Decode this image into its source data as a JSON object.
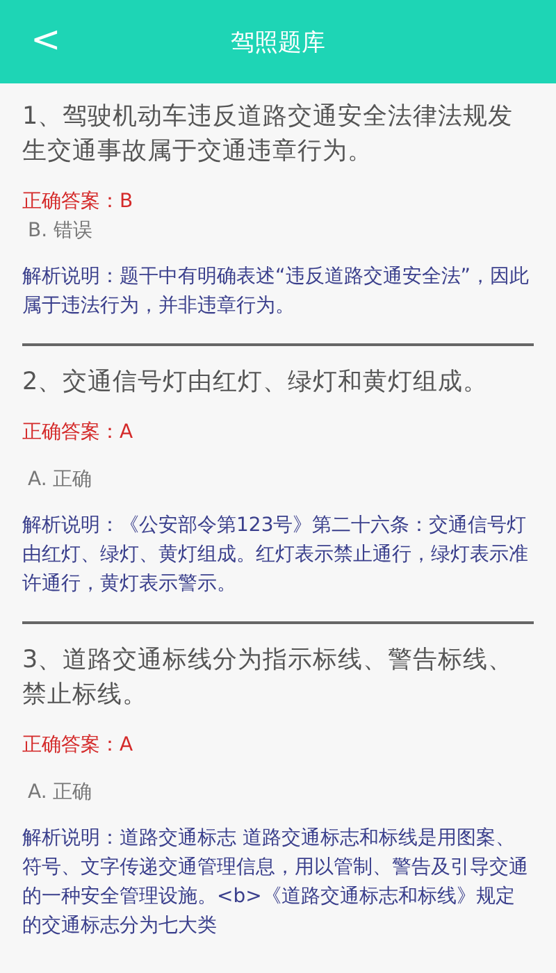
{
  "header": {
    "back": "<",
    "title": "驾照题库"
  },
  "questions": [
    {
      "question": "1、驾驶机动车违反道路交通安全法律法规发生交通事故属于交通违章行为。",
      "answer": "正确答案：B",
      "option": "B. 错误",
      "explanation": "解析说明：题干中有明确表述“违反道路交通安全法”，因此属于违法行为，并非违章行为。"
    },
    {
      "question": "2、交通信号灯由红灯、绿灯和黄灯组成。",
      "answer": "正确答案：A",
      "option": "A. 正确",
      "explanation": "解析说明：《公安部令第123号》第二十六条：交通信号灯由红灯、绿灯、黄灯组成。红灯表示禁止通行，绿灯表示准许通行，黄灯表示警示。"
    },
    {
      "question": "3、道路交通标线分为指示标线、警告标线、禁止标线。",
      "answer": "正确答案：A",
      "option": "A. 正确",
      "explanation": "解析说明：道路交通标志  道路交通标志和标线是用图案、符号、文字传递交通管理信息，用以管制、警告及引导交通的一种安全管理设施。<b>《道路交通标志和标线》规定的交通标志分为七大类"
    }
  ]
}
